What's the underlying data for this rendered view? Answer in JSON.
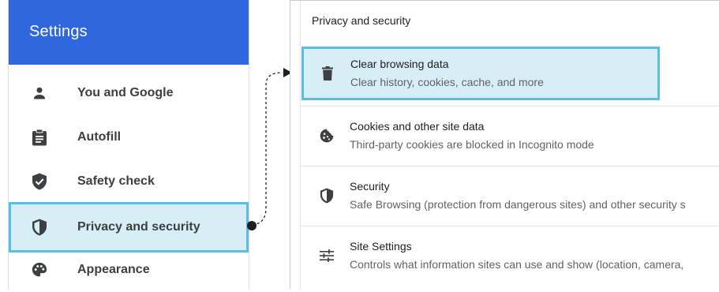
{
  "sidebar": {
    "title": "Settings",
    "items": [
      {
        "label": "You and Google",
        "icon": "person-icon"
      },
      {
        "label": "Autofill",
        "icon": "clipboard-icon"
      },
      {
        "label": "Safety check",
        "icon": "shield-check-icon"
      },
      {
        "label": "Privacy and security",
        "icon": "shield-half-icon",
        "selected": true
      },
      {
        "label": "Appearance",
        "icon": "palette-icon"
      }
    ]
  },
  "panel": {
    "title": "Privacy and security",
    "rows": [
      {
        "title": "Clear browsing data",
        "subtitle": "Clear history, cookies, cache, and more",
        "icon": "trash-icon",
        "highlighted": true
      },
      {
        "title": "Cookies and other site data",
        "subtitle": "Third-party cookies are blocked in Incognito mode",
        "icon": "cookie-icon"
      },
      {
        "title": "Security",
        "subtitle": "Safe Browsing (protection from dangerous sites) and other security s",
        "icon": "shield-half-icon"
      },
      {
        "title": "Site Settings",
        "subtitle": "Controls what information sites can use and show (location, camera,",
        "icon": "tune-icon"
      }
    ]
  },
  "colors": {
    "header_blue": "#2f67df",
    "highlight_fill": "#d8eef7",
    "highlight_border": "#5bbde0",
    "icon_dark": "#3c4043"
  }
}
